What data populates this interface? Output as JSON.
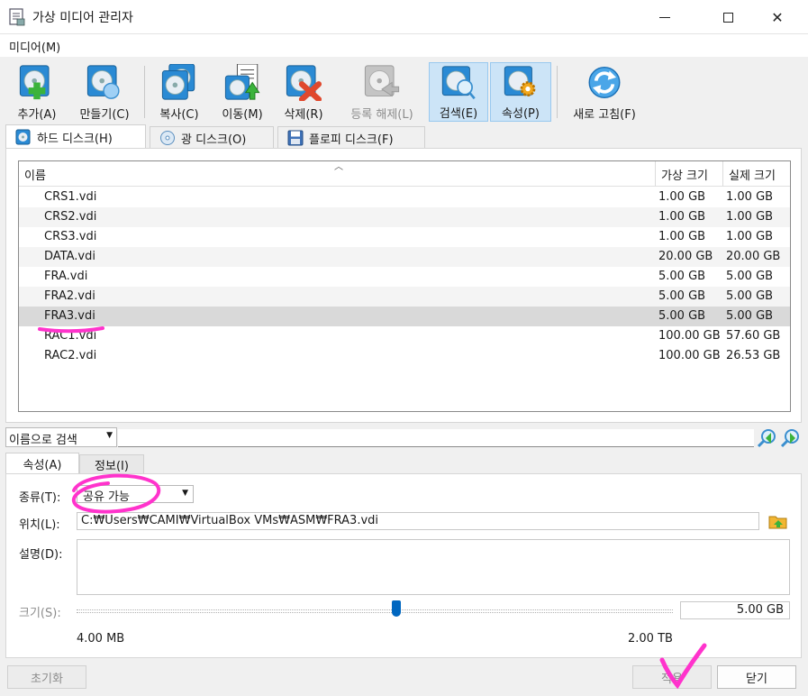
{
  "window": {
    "title": "가상 미디어 관리자",
    "controls": {
      "minimize": "minimize-icon",
      "maximize": "maximize-icon",
      "close": "✕"
    }
  },
  "menubar": {
    "media": "미디어(M)"
  },
  "toolbar": {
    "add": "추가(A)",
    "create": "만들기(C)",
    "copy": "복사(C)",
    "move": "이동(M)",
    "remove": "삭제(R)",
    "release": "등록 해제(L)",
    "search": "검색(E)",
    "properties": "속성(P)",
    "refresh": "새로 고침(F)"
  },
  "tabs": {
    "hard_disk": "하드 디스크(H)",
    "optical_disk": "광 디스크(O)",
    "floppy_disk": "플로피 디스크(F)"
  },
  "table": {
    "columns": {
      "name": "이름",
      "virtual_size": "가상 크기",
      "actual_size": "실제 크기"
    },
    "rows": [
      {
        "name": "CRS1.vdi",
        "virtual_size": "1.00 GB",
        "actual_size": "1.00 GB"
      },
      {
        "name": "CRS2.vdi",
        "virtual_size": "1.00 GB",
        "actual_size": "1.00 GB"
      },
      {
        "name": "CRS3.vdi",
        "virtual_size": "1.00 GB",
        "actual_size": "1.00 GB"
      },
      {
        "name": "DATA.vdi",
        "virtual_size": "20.00 GB",
        "actual_size": "20.00 GB"
      },
      {
        "name": "FRA.vdi",
        "virtual_size": "5.00 GB",
        "actual_size": "5.00 GB"
      },
      {
        "name": "FRA2.vdi",
        "virtual_size": "5.00 GB",
        "actual_size": "5.00 GB"
      },
      {
        "name": "FRA3.vdi",
        "virtual_size": "5.00 GB",
        "actual_size": "5.00 GB"
      },
      {
        "name": "RAC1.vdi",
        "virtual_size": "100.00 GB",
        "actual_size": "57.60 GB"
      },
      {
        "name": "RAC2.vdi",
        "virtual_size": "100.00 GB",
        "actual_size": "26.53 GB"
      }
    ],
    "selected_row": "FRA3.vdi"
  },
  "search": {
    "mode": "이름으로 검색",
    "query": ""
  },
  "details_tabs": {
    "attributes": "속성(A)",
    "information": "정보(I)"
  },
  "attributes": {
    "type_label": "종류(T):",
    "type_value": "공유 가능",
    "location_label": "위치(L):",
    "location_value": "C:\\Users\\CAMI\\VirtualBox VMs\\ASM\\FRA3.vdi",
    "location_display": "C:₩Users₩CAMI₩VirtualBox VMs₩ASM₩FRA3.vdi",
    "description_label": "설명(D):",
    "description_value": "",
    "size_label": "크기(S):",
    "size_value": "5.00 GB",
    "size_min": "4.00 MB",
    "size_max": "2.00 TB"
  },
  "buttons": {
    "reset": "초기화",
    "apply": "적용",
    "close": "닫기"
  },
  "colors": {
    "accent": "#0067c0",
    "annotation": "#ff33cc",
    "selection": "#d9d9d9"
  }
}
